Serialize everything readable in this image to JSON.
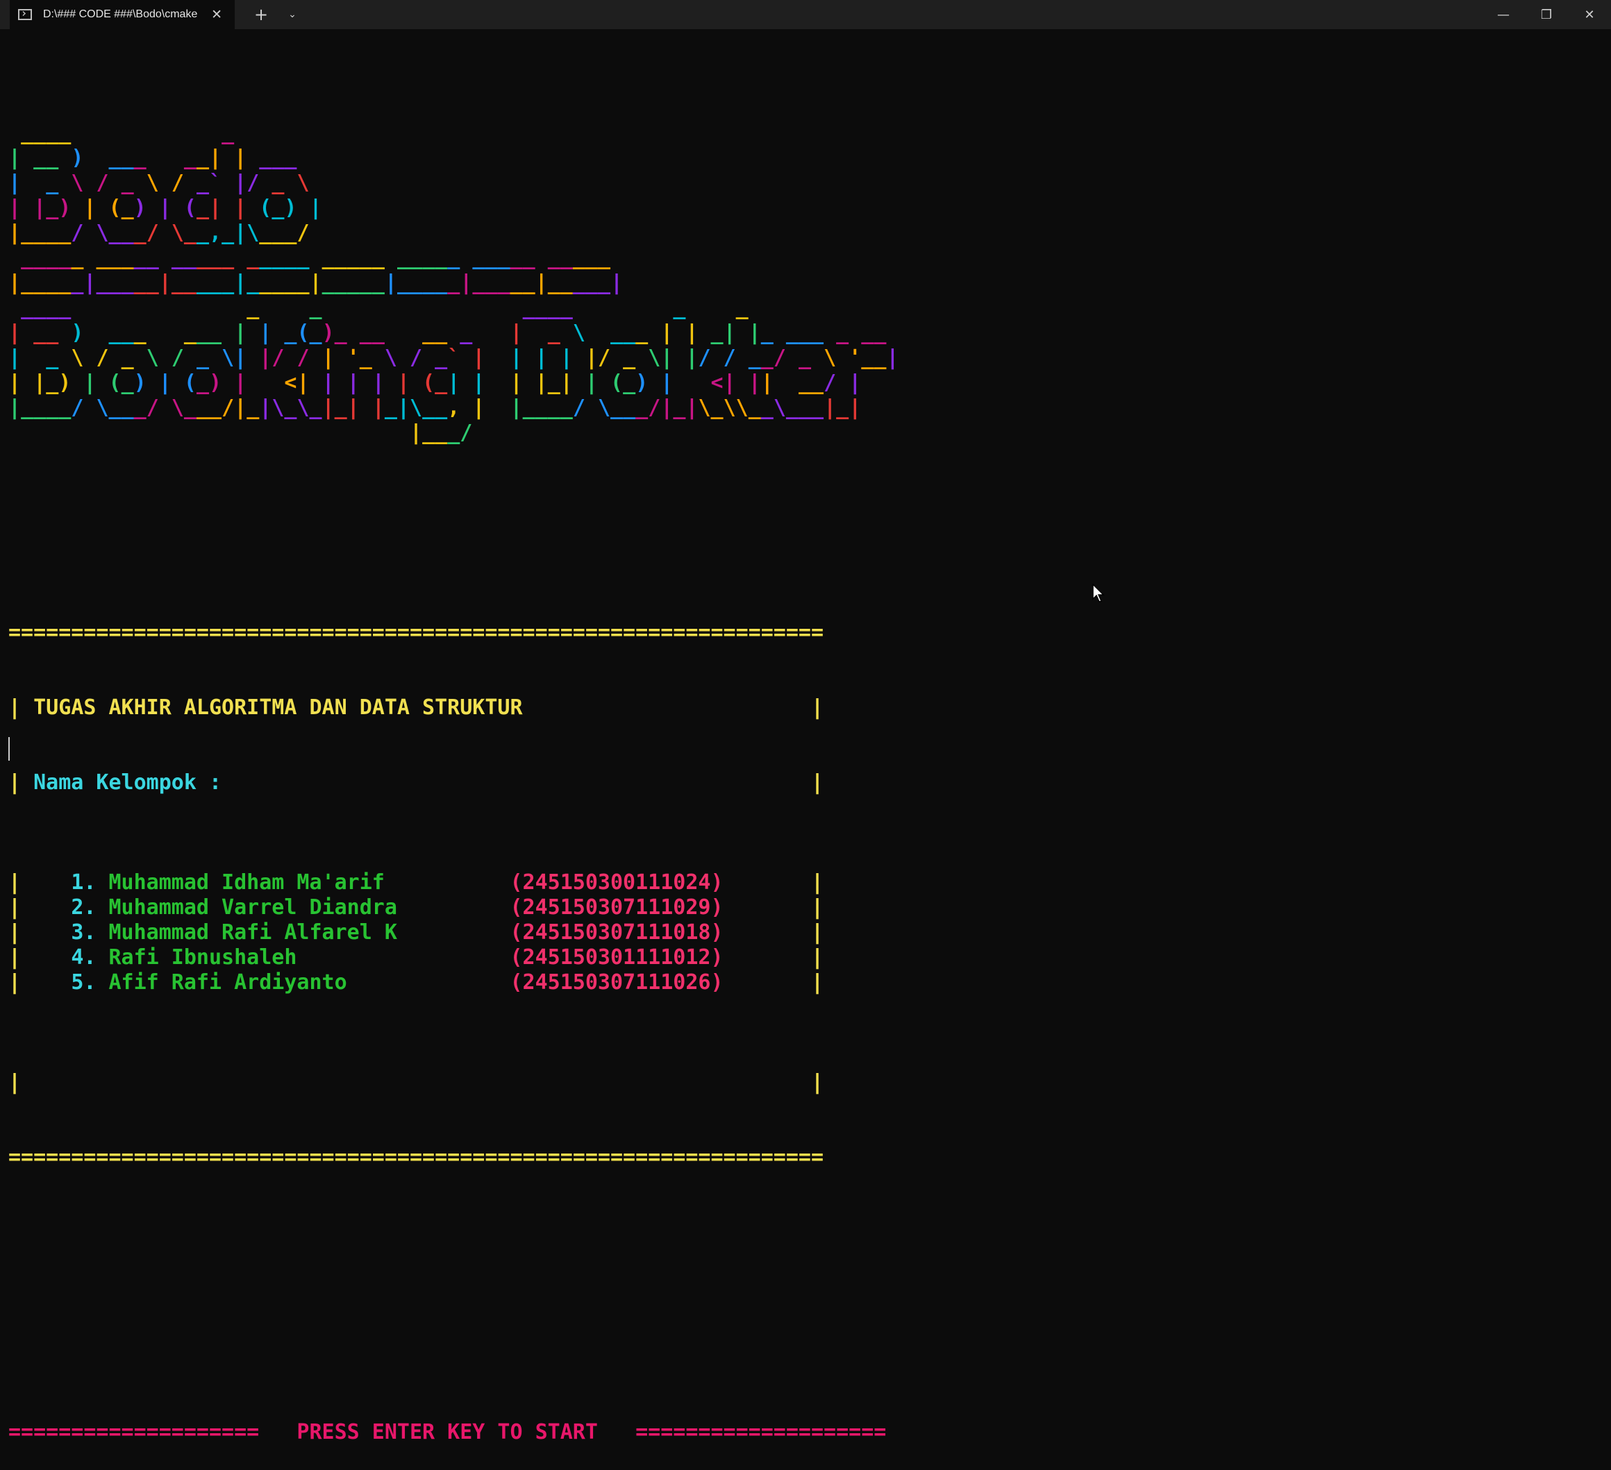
{
  "window": {
    "tab_title": "D:\\### CODE ###\\Bodo\\cmake",
    "close_tab_glyph": "✕",
    "new_tab_glyph": "+",
    "dropdown_glyph": "⌄",
    "minimize_glyph": "—",
    "restore_glyph": "❐",
    "close_glyph": "✕"
  },
  "banner": {
    "bodo_lines": [
      " ____            _       ",
      "| __ )  ___   __| | ___  ",
      "|  _ \\ / _ \\ / _` |/ _ \\ ",
      "| |_) | (_) | (_| | (_) |",
      "|____/ \\___/ \\__,_|\\___/ "
    ],
    "divider_lines": [
      " _____ _____ _____ _____ _____ _____ _____ _____ ",
      "|_____|_____|_____|_____|_____|_____|_____|_____|"
    ],
    "booking_lines": [
      " ____              _    _                ____        _    _            ",
      "| __ )  ___   ___ | | _(_)_ __   __ _   |  _ \\  ___ | | _| |_ ___ _ __ ",
      "|  _ \\ / _ \\ / _ \\| |/ / | '_ \\ / _` |  | | | |/ _ \\| |/ / __/ _ \\ '__|",
      "| |_) | (_) | (_) |   <| | | | | (_| |  | |_| | (_) |   <| ||  __/ |   ",
      "|____/ \\___/ \\___/|_|\\_\\_|_| |_|\\__, |  |____/ \\___/|_|\\_\\\\__\\___|_|   ",
      "                                |___/                                  "
    ],
    "colors": [
      "#f1c40f",
      "#2ecc71",
      "#1e90ff",
      "#c71585",
      "#ffa500",
      "#8a2be2",
      "#e53935",
      "#00bcd4"
    ]
  },
  "info_box": {
    "border_rule": "=================================================================",
    "left_edge": "|",
    "right_edge": "|",
    "course_title": "TUGAS AKHIR ALGORITMA DAN DATA STRUKTUR",
    "group_label": "Nama Kelompok :",
    "members": [
      {
        "num": "1.",
        "name": "Muhammad Idham Ma'arif",
        "nim": "(245150300111024)"
      },
      {
        "num": "2.",
        "name": "Muhammad Varrel Diandra",
        "nim": "(245150307111029)"
      },
      {
        "num": "3.",
        "name": "Muhammad Rafi Alfarel K",
        "nim": "(245150307111018)"
      },
      {
        "num": "4.",
        "name": "Rafi Ibnushaleh",
        "nim": "(245150301111012)"
      },
      {
        "num": "5.",
        "name": "Afif Rafi Ardiyanto",
        "nim": "(245150307111026)"
      }
    ]
  },
  "prompt": {
    "left_rule": "====================",
    "text": "PRESS ENTER KEY TO START",
    "right_rule": "===================="
  },
  "icons": {
    "terminal_tab_icon": "terminal-icon",
    "mouse": "mouse-pointer-icon"
  }
}
